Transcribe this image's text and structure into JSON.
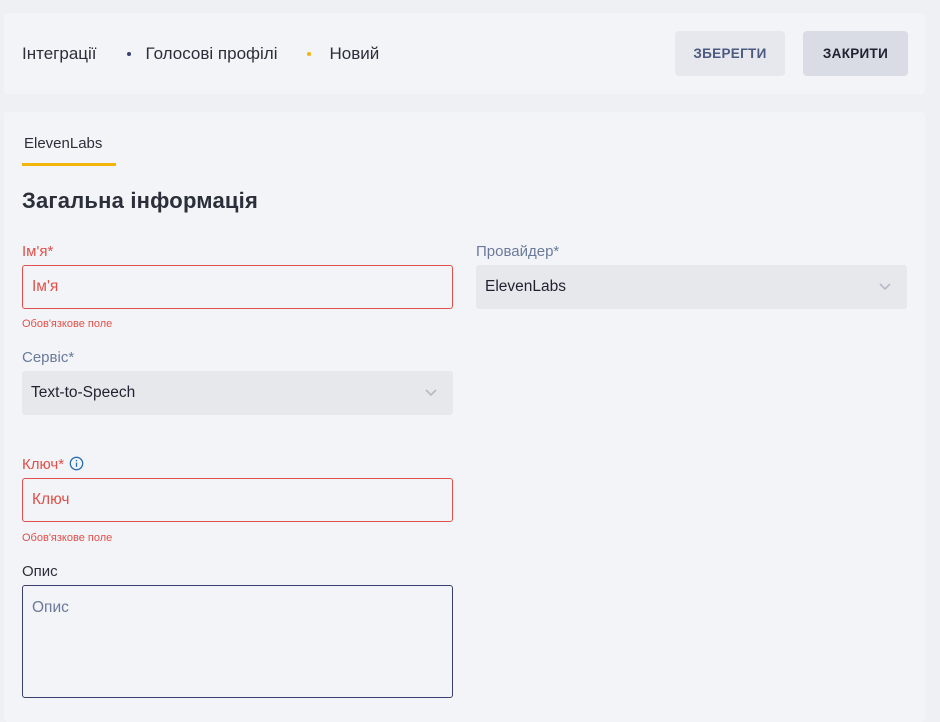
{
  "breadcrumb": {
    "items": [
      "Інтеграції",
      "Голосові профілі",
      "Новий"
    ]
  },
  "actions": {
    "save_label": "ЗБЕРЕГТИ",
    "close_label": "ЗАКРИТИ"
  },
  "tabs": [
    {
      "label": "ElevenLabs",
      "active": true
    }
  ],
  "section": {
    "title": "Загальна інформація"
  },
  "form": {
    "name": {
      "label": "Ім'я*",
      "placeholder": "Ім'я",
      "value": "",
      "error": "Обов'язкове поле"
    },
    "provider": {
      "label": "Провайдер*",
      "value": "ElevenLabs"
    },
    "service": {
      "label": "Сервіс*",
      "value": "Text-to-Speech"
    },
    "key": {
      "label": "Ключ*",
      "placeholder": "Ключ",
      "value": "",
      "error": "Обов'язкове поле",
      "info_icon": "info-icon"
    },
    "description": {
      "label": "Опис",
      "placeholder": "Опис",
      "value": ""
    }
  },
  "colors": {
    "accent": "#f5b40a",
    "error": "#e0504a",
    "background": "#eef0f4",
    "panel": "#f3f4f8"
  }
}
